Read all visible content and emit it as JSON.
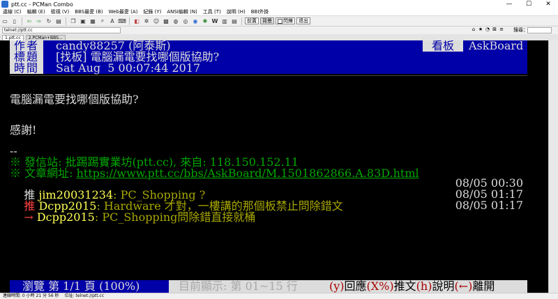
{
  "window": {
    "title": "ptt.cc - PCMan Combo",
    "controls": [
      "—",
      "☐",
      "✕"
    ]
  },
  "menu": [
    "違線 (C)",
    "編輯 (E)",
    "檢視 (V)",
    "BBS最愛 (B)",
    "Web最愛 (A)",
    "紀錄 (Y)",
    "ANSI編輯 (N)",
    "工具 (T)",
    "說明 (H)",
    "BBI外掛"
  ],
  "toolbar": {
    "btn_front": "前置",
    "btn_back": "背景",
    "blink_label": "閃爍",
    "exit_label": "退出"
  },
  "address": {
    "value": "telnet://ptt.cc",
    "search_label": "搜尋："
  },
  "tabs": [
    "1.ptt.cc",
    "2.PCMan+BBS..."
  ],
  "terminal": {
    "header": {
      "author_label": "作者",
      "author": "candy88257 (阿泰斯)",
      "title_label": "標題",
      "title": "[找板] 電腦漏電要找哪個版協助?",
      "time_label": "時間",
      "time": "Sat Aug  5 00:07:44 2017",
      "board_label": "看板",
      "board": "AskBoard"
    },
    "body": [
      "電腦漏電要找哪個版協助?",
      "感謝!"
    ],
    "sig_dash": "--",
    "source": "※ 發信站: 批踢踢實業坊(ptt.cc), 來自: 118.150.152.11",
    "url_prefix": "※ 文章網址: ",
    "url": "https://www.ptt.cc/bbs/AskBoard/M.1501862866.A.83D.html",
    "pushes": [
      {
        "tag": "推",
        "user": "jim20031234",
        "text": ": PC_Shopping ?",
        "time": "08/05 00:30"
      },
      {
        "tag": "推",
        "user": "Dcpp2015",
        "text": ": Hardware 才對，一樓講的那個板禁止問除錯文",
        "time": "08/05 01:17"
      },
      {
        "tag": "→",
        "user": "Dcpp2015",
        "text": ": PC_Shopping問除錯直接就桶",
        "time": "08/05 01:17"
      }
    ],
    "status": {
      "browse": "瀏覽 第 1/1 頁 (100%)",
      "display": "目前顯示: 第 01~15 行",
      "reply_key": "(y)",
      "reply": "回應",
      "push_key": "(X%)",
      "push": "推文",
      "help_key": "(h)",
      "help": "說明",
      "leave_key": "(←)",
      "leave": "離開"
    }
  },
  "statusbar": {
    "connected": "連線時間: 0 小時 21 分 56 秒",
    "position": "位址: telnet://ptt.cc"
  },
  "colors": {
    "header_bg": "#0000a8",
    "terminal_bg": "#000000",
    "push_user": "#ffff54",
    "push_text": "#a8a800",
    "signature": "#00a800"
  }
}
